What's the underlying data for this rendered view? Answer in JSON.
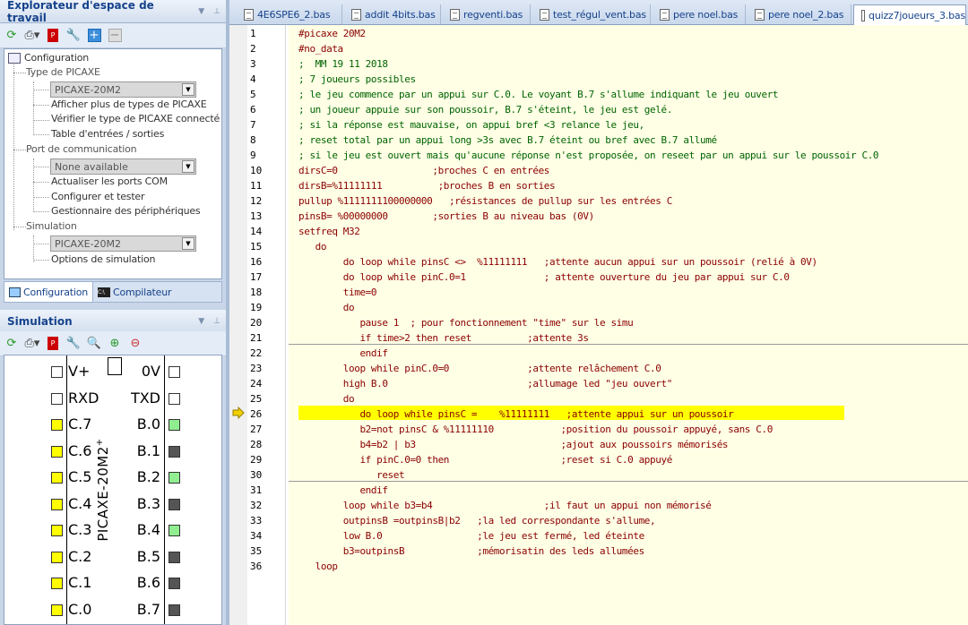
{
  "explorer": {
    "title": "Explorateur d'espace de travail",
    "tree": {
      "root": "Configuration",
      "picaxe_type_label": "Type de PICAXE",
      "picaxe_type_value": "PICAXE-20M2",
      "more_types": "Afficher plus de types de PICAXE",
      "check_type": "Vérifier le type de PICAXE connecté",
      "io_table": "Table d'entrées / sorties",
      "comm_port_label": "Port de communication",
      "comm_port_value": "None available",
      "refresh_ports": "Actualiser les ports COM",
      "config_test": "Configurer et tester",
      "device_manager": "Gestionnaire des périphériques",
      "simulation_label": "Simulation",
      "simulation_value": "PICAXE-20M2",
      "sim_options": "Options de simulation"
    },
    "tabs": [
      "Configuration",
      "Compilateur"
    ]
  },
  "simulation": {
    "title": "Simulation",
    "chip_name": "PICAXE-20M2",
    "chip_suffix": "+",
    "pins": [
      {
        "left": "V+",
        "right": "0V",
        "left_color": "#ffffff",
        "right_color": "#ffffff"
      },
      {
        "left": "RXD",
        "right": "TXD",
        "left_color": "#ffffff",
        "right_color": "#ffffff"
      },
      {
        "left": "C.7",
        "right": "B.0",
        "left_color": "#ffff00",
        "right_color": "#90ee90"
      },
      {
        "left": "C.6",
        "right": "B.1",
        "left_color": "#ffff00",
        "right_color": "#555555"
      },
      {
        "left": "C.5",
        "right": "B.2",
        "left_color": "#ffff00",
        "right_color": "#90ee90"
      },
      {
        "left": "C.4",
        "right": "B.3",
        "left_color": "#ffff00",
        "right_color": "#555555"
      },
      {
        "left": "C.3",
        "right": "B.4",
        "left_color": "#ffff00",
        "right_color": "#90ee90"
      },
      {
        "left": "C.2",
        "right": "B.5",
        "left_color": "#ffff00",
        "right_color": "#555555"
      },
      {
        "left": "C.1",
        "right": "B.6",
        "left_color": "#ffff00",
        "right_color": "#555555"
      },
      {
        "left": "C.0",
        "right": "B.7",
        "left_color": "#ffff00",
        "right_color": "#555555"
      }
    ]
  },
  "editor": {
    "tabs": [
      "4E6SPE6_2.bas",
      "addit 4bits.bas",
      "regventi.bas",
      "test_régul_vent.bas",
      "pere noel.bas",
      "pere noel_2.bas",
      "quizz7joueurs_3.bas"
    ],
    "active_tab": 6,
    "highlight_line": 26,
    "lines": [
      {
        "n": "1",
        "t": "#picaxe 20M2"
      },
      {
        "n": "2",
        "t": "#no_data"
      },
      {
        "n": "3",
        "t": ";  MM 19 11 2018"
      },
      {
        "n": "4",
        "t": "; 7 joueurs possibles"
      },
      {
        "n": "5",
        "t": "; le jeu commence par un appui sur C.0. Le voyant B.7 s'allume indiquant le jeu ouvert"
      },
      {
        "n": "6",
        "t": "; un joueur appuie sur son poussoir, B.7 s'éteint, le jeu est gelé."
      },
      {
        "n": "7",
        "t": "; si la réponse est mauvaise, on appui bref <3 relance le jeu,"
      },
      {
        "n": "8",
        "t": "; reset total par un appui long >3s avec B.7 éteint ou bref avec B.7 allumé"
      },
      {
        "n": "9",
        "t": "; si le jeu est ouvert mais qu'aucune réponse n'est proposée, on reseet par un appui sur le poussoir C.0"
      },
      {
        "n": "10",
        "t": "dirsC=0                 ;broches C en entrées"
      },
      {
        "n": "11",
        "t": "dirsB=%11111111          ;broches B en sorties"
      },
      {
        "n": "12",
        "t": "pullup %1111111100000000   ;résistances de pullup sur les entrées C"
      },
      {
        "n": "13",
        "t": "pinsB= %00000000        ;sorties B au niveau bas (0V)"
      },
      {
        "n": "14",
        "t": "setfreq M32"
      },
      {
        "n": "15",
        "t": "   do"
      },
      {
        "n": "16",
        "t": "        do loop while pinsC <>  %11111111   ;attente aucun appui sur un poussoir (relié à 0V)"
      },
      {
        "n": "17",
        "t": "        do loop while pinC.0=1              ; attente ouverture du jeu par appui sur C.0"
      },
      {
        "n": "18",
        "t": "        time=0"
      },
      {
        "n": "19",
        "t": "        do"
      },
      {
        "n": "20",
        "t": "           pause 1  ; pour fonctionnement \"time\" sur le simu"
      },
      {
        "n": "21",
        "t": "           if time>2 then reset          ;attente 3s"
      },
      {
        "n": "22",
        "t": "           endif"
      },
      {
        "n": "23",
        "t": "        loop while pinC.0=0              ;attente relâchement C.0"
      },
      {
        "n": "24",
        "t": "        high B.0                         ;allumage led \"jeu ouvert\""
      },
      {
        "n": "25",
        "t": "        do"
      },
      {
        "n": "26",
        "t": "           do loop while pinsC =    %11111111   ;attente appui sur un poussoir"
      },
      {
        "n": "27",
        "t": "           b2=not pinsC & %11111110            ;position du poussoir appuyé, sans C.0"
      },
      {
        "n": "28",
        "t": "           b4=b2 | b3                          ;ajout aux poussoirs mémorisés"
      },
      {
        "n": "29",
        "t": "           if pinC.0=0 then                    ;reset si C.0 appuyé"
      },
      {
        "n": "30",
        "t": "              reset"
      },
      {
        "n": "31",
        "t": "           endif"
      },
      {
        "n": "32",
        "t": "        loop while b3=b4                    ;il faut un appui non mémorisé"
      },
      {
        "n": "33",
        "t": "        outpinsB =outpinsB|b2   ;la led correspondante s'allume,"
      },
      {
        "n": "34",
        "t": "        low B.0                 ;le jeu est fermé, led éteinte"
      },
      {
        "n": "35",
        "t": "        b3=outpinsB             ;mémorisatin des leds allumées"
      },
      {
        "n": "36",
        "t": "   loop"
      }
    ]
  }
}
